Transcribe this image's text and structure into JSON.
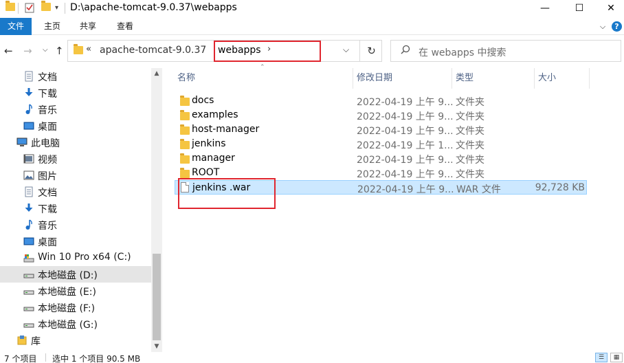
{
  "window": {
    "title": "D:\\apache-tomcat-9.0.37\\webapps",
    "minimize": "—",
    "maximize": "☐",
    "close": "✕"
  },
  "ribbon": {
    "tabs": [
      "文件",
      "主页",
      "共享",
      "查看"
    ],
    "collapse": "⌵",
    "help": "?"
  },
  "nav": {
    "back": "←",
    "forward": "→",
    "recent": "⌵",
    "up": "↑"
  },
  "address": {
    "overflow": "«",
    "parent": "apache-tomcat-9.0.37",
    "current": "webapps",
    "sep": "›",
    "dropdown": "⌵",
    "refresh": "↻"
  },
  "search": {
    "placeholder": "在 webapps 中搜索"
  },
  "sidebar": {
    "items": [
      {
        "label": "文档",
        "icon": "documents-icon"
      },
      {
        "label": "下载",
        "icon": "downloads-icon"
      },
      {
        "label": "音乐",
        "icon": "music-icon"
      },
      {
        "label": "桌面",
        "icon": "desktop-icon"
      },
      {
        "label": "此电脑",
        "icon": "this-pc-icon"
      },
      {
        "label": "视频",
        "icon": "videos-icon"
      },
      {
        "label": "图片",
        "icon": "pictures-icon"
      },
      {
        "label": "文档",
        "icon": "documents-icon"
      },
      {
        "label": "下载",
        "icon": "downloads-icon"
      },
      {
        "label": "音乐",
        "icon": "music-icon"
      },
      {
        "label": "桌面",
        "icon": "desktop-icon"
      },
      {
        "label": "Win 10 Pro x64 (C:)",
        "icon": "system-drive-icon"
      },
      {
        "label": "本地磁盘 (D:)",
        "icon": "drive-icon"
      },
      {
        "label": "本地磁盘 (E:)",
        "icon": "drive-icon"
      },
      {
        "label": "本地磁盘 (F:)",
        "icon": "drive-icon"
      },
      {
        "label": "本地磁盘 (G:)",
        "icon": "drive-icon"
      },
      {
        "label": "库",
        "icon": "library-icon"
      }
    ],
    "selected_index": 12
  },
  "columns": {
    "name": "名称",
    "date": "修改日期",
    "type": "类型",
    "size": "大小"
  },
  "files": [
    {
      "name": "docs",
      "date": "2022-04-19 上午 9...",
      "type": "文件夹",
      "size": "",
      "icon": "folder-icon"
    },
    {
      "name": "examples",
      "date": "2022-04-19 上午 9...",
      "type": "文件夹",
      "size": "",
      "icon": "folder-icon"
    },
    {
      "name": "host-manager",
      "date": "2022-04-19 上午 9...",
      "type": "文件夹",
      "size": "",
      "icon": "folder-icon"
    },
    {
      "name": "jenkins",
      "date": "2022-04-19 上午 1...",
      "type": "文件夹",
      "size": "",
      "icon": "folder-icon"
    },
    {
      "name": "manager",
      "date": "2022-04-19 上午 9...",
      "type": "文件夹",
      "size": "",
      "icon": "folder-icon"
    },
    {
      "name": "ROOT",
      "date": "2022-04-19 上午 9...",
      "type": "文件夹",
      "size": "",
      "icon": "folder-icon"
    },
    {
      "name": "jenkins .war",
      "date": "2022-04-19 上午 9...",
      "type": "WAR 文件",
      "size": "92,728 KB",
      "icon": "file-icon"
    }
  ],
  "selected_file_index": 6,
  "status": {
    "count": "7 个项目",
    "selection": "选中 1 个项目  90.5 MB"
  },
  "colors": {
    "accent": "#1979ca",
    "selection": "#cce8ff",
    "highlight_box": "#e0252e",
    "folder": "#f5c542"
  }
}
